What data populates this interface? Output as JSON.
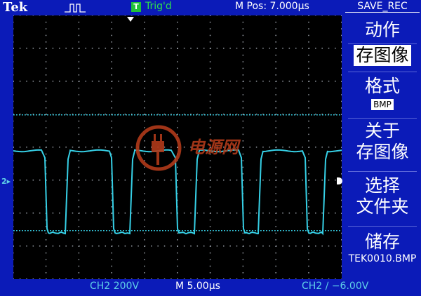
{
  "brand": "Tek",
  "acquire_icon": "pulse-waveform-icon",
  "trigger": {
    "badge": "T",
    "status": "Trig'd"
  },
  "horizontal": {
    "position": "M Pos: 7.000µs",
    "timebase": "M 5.00µs"
  },
  "menu": {
    "title": "SAVE_REC",
    "items": [
      {
        "label": "动作"
      },
      {
        "label": "存图像",
        "selected": true
      },
      {
        "label": "格式",
        "value": "BMP"
      },
      {
        "label": "关于",
        "label2": "存图像"
      },
      {
        "label": "选择",
        "label2": "文件夹"
      },
      {
        "label": "储存",
        "value": "TEK0010.BMP"
      }
    ]
  },
  "channel": {
    "marker": "2",
    "scale": "CH2  200V"
  },
  "trigger_readout": "CH2 ∕ −6.00V",
  "watermark": {
    "text": "电源网"
  },
  "colors": {
    "background": "#0b1bb8",
    "trace": "#36d0e6",
    "trigger_ok": "#2ee04a",
    "graticule": "#000000"
  }
}
